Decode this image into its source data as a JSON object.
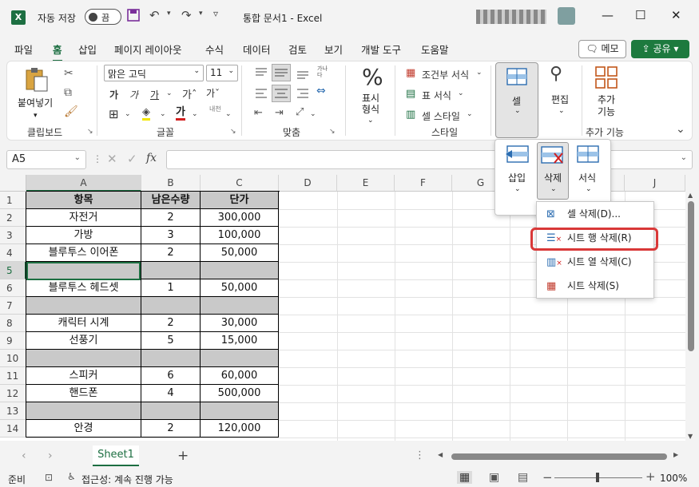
{
  "title_bar": {
    "autosave_label": "자동 저장",
    "toggle_label": "끔",
    "doc_title": "통합 문서1  -  Excel",
    "app_icon": "X"
  },
  "menu": {
    "items": [
      "파일",
      "홈",
      "삽입",
      "페이지 레이아웃",
      "수식",
      "데이터",
      "검토",
      "보기",
      "개발 도구",
      "도움말"
    ],
    "active": "홈",
    "memo_label": "메모",
    "share_label": "공유"
  },
  "ribbon": {
    "clipboard": {
      "paste": "붙여넣기",
      "group": "클립보드"
    },
    "font": {
      "name": "맑은 고딕",
      "size": "11",
      "group": "글꼴",
      "bold": "가",
      "italic": "가",
      "underline": "가",
      "phonetic": "내천"
    },
    "align": {
      "group": "맞춤",
      "wrap": "가나다"
    },
    "number": {
      "percent": "%",
      "label": "표시 형식"
    },
    "style": {
      "conditional": "조건부 서식",
      "table": "표 서식",
      "cell_style": "셀 스타일",
      "group": "스타일"
    },
    "cells": {
      "label": "셀"
    },
    "editing": {
      "label": "편집"
    },
    "addins": {
      "label": "추가 기능",
      "group": "추가 기능"
    }
  },
  "formula_bar": {
    "name_box": "A5",
    "fx": "fx",
    "value": ""
  },
  "grid": {
    "columns": [
      "A",
      "B",
      "C",
      "D",
      "E",
      "F",
      "G",
      "H",
      "I",
      "J"
    ],
    "rows": [
      "1",
      "2",
      "3",
      "4",
      "5",
      "6",
      "7",
      "8",
      "9",
      "10",
      "11",
      "12",
      "13",
      "14"
    ],
    "header": [
      "항목",
      "남은수량",
      "단가"
    ],
    "data": [
      [
        "자전거",
        "2",
        "300,000"
      ],
      [
        "가방",
        "3",
        "100,000"
      ],
      [
        "블루투스 이어폰",
        "2",
        "50,000"
      ],
      [
        "",
        "",
        ""
      ],
      [
        "블루투스 헤드셋",
        "1",
        "50,000"
      ],
      [
        "",
        "",
        ""
      ],
      [
        "캐릭터 시계",
        "2",
        "30,000"
      ],
      [
        "선풍기",
        "5",
        "15,000"
      ],
      [
        "",
        "",
        ""
      ],
      [
        "스피커",
        "6",
        "60,000"
      ],
      [
        "핸드폰",
        "4",
        "500,000"
      ],
      [
        "",
        "",
        ""
      ],
      [
        "안경",
        "2",
        "120,000"
      ]
    ],
    "empty_rows": [
      4,
      6,
      9,
      12
    ]
  },
  "cells_popup": {
    "insert": "삽입",
    "delete": "삭제",
    "format": "서식"
  },
  "delete_menu": {
    "items": [
      "셀 삭제(D)...",
      "시트 행 삭제(R)",
      "시트 열 삭제(C)",
      "시트 삭제(S)"
    ],
    "highlighted": "시트 행 삭제(R)"
  },
  "sheet_tab": "Sheet1",
  "status": {
    "ready": "준비",
    "accessibility": "접근성: 계속 진행 가능",
    "zoom": "100%"
  },
  "colors": {
    "excel_green": "#1d6f42",
    "empty_row_fill": "#c9c9c9",
    "highlight_border": "#d93838"
  }
}
